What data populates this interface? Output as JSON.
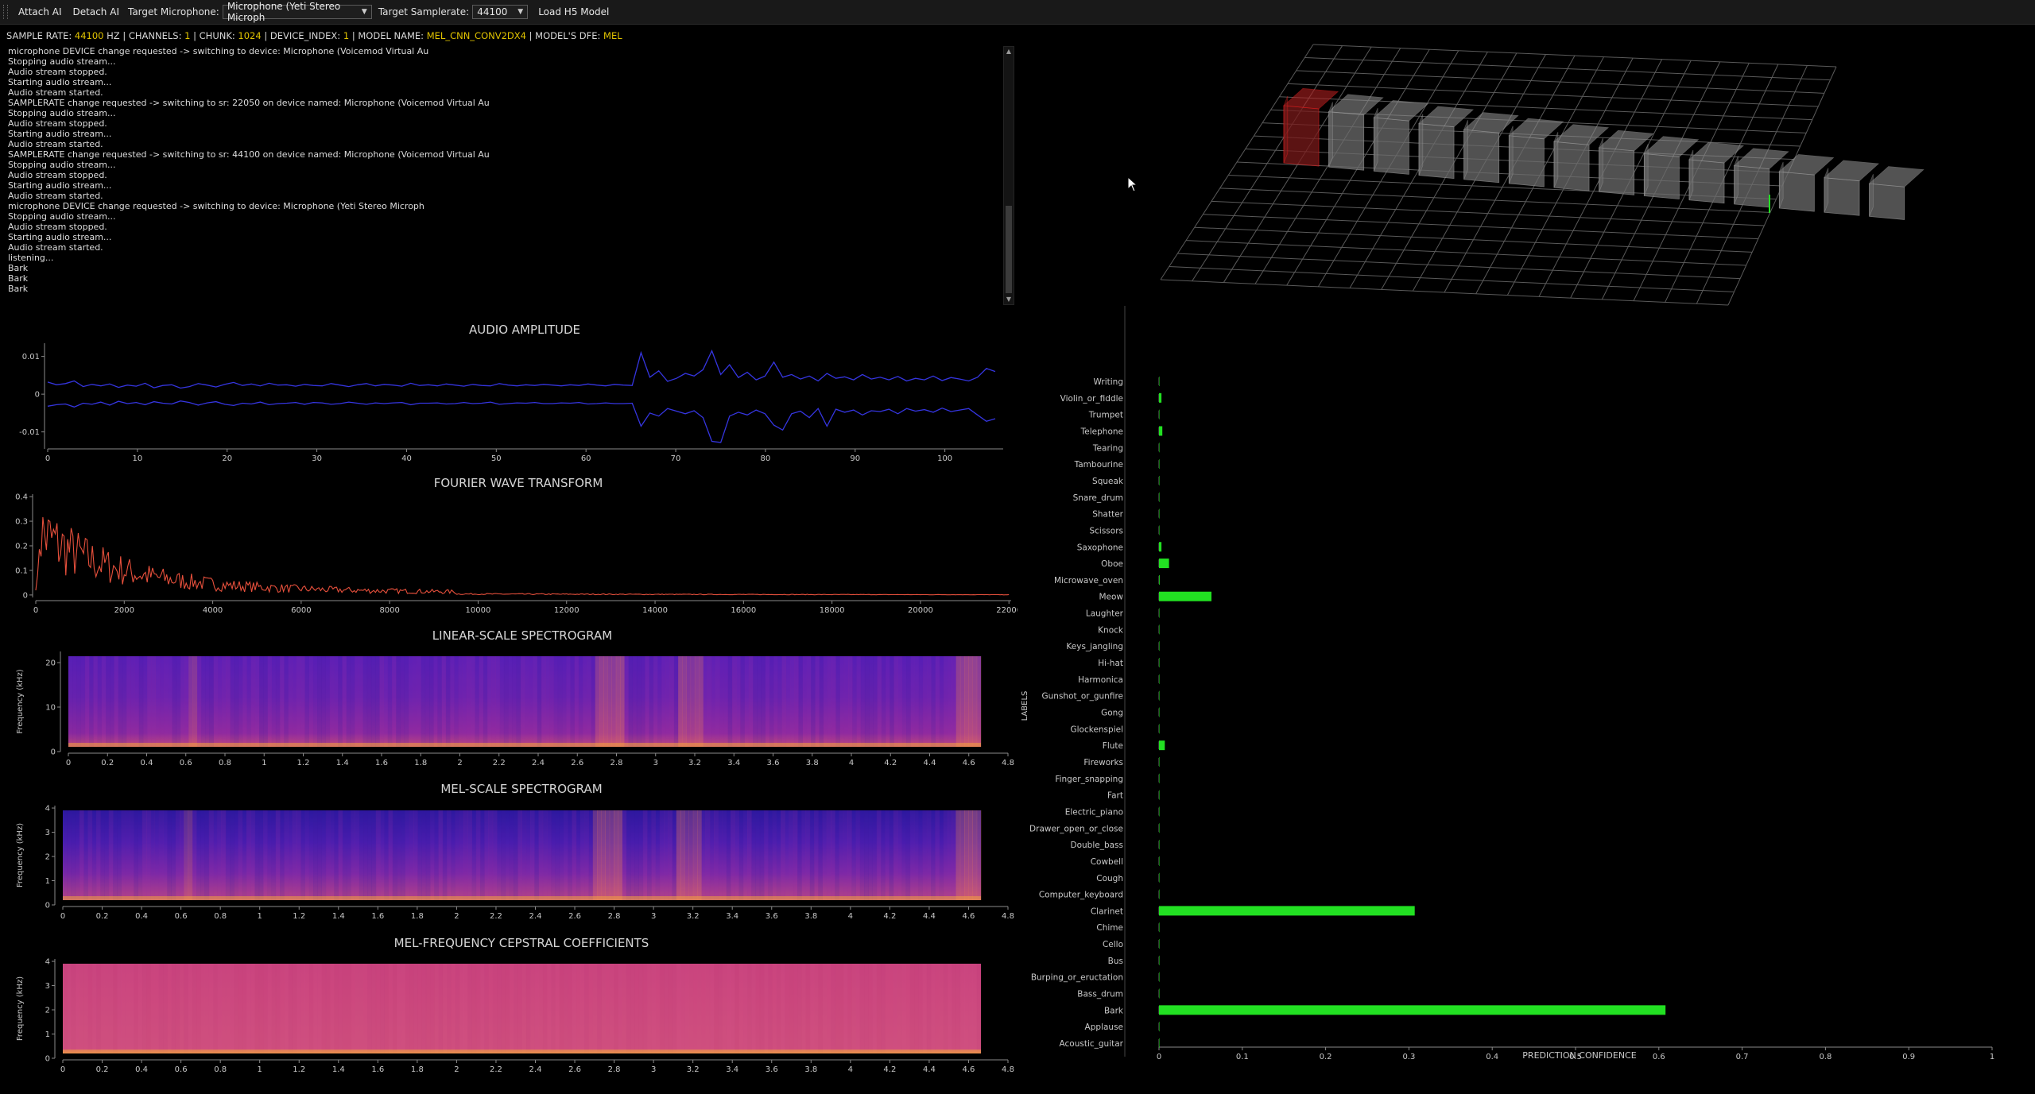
{
  "toolbar": {
    "attach": "Attach AI",
    "detach": "Detach AI",
    "mic_label": "Target Microphone:",
    "mic_value": "Microphone (Yeti Stereo Microph",
    "sr_label": "Target Samplerate:",
    "sr_value": "44100",
    "load": "Load H5 Model"
  },
  "info": {
    "sr_label": "SAMPLE RATE:",
    "sr_value": "44100",
    "sr_unit": "HZ |",
    "ch_label": "CHANNELS:",
    "ch_value": "1",
    "ch_sep": "|",
    "chunk_label": "CHUNK:",
    "chunk_value": "1024",
    "chunk_sep": "|",
    "dev_label": "DEVICE_INDEX:",
    "dev_value": "1",
    "dev_sep": "|",
    "model_label": "MODEL NAME:",
    "model_value": "MEL_CNN_CONV2DX4",
    "model_sep": "|",
    "dfe_label": "MODEL'S DFE:",
    "dfe_value": "MEL"
  },
  "log": [
    "microphone DEVICE change requested -> switching to device: Microphone (Voicemod Virtual Au",
    "Stopping audio stream...",
    "Audio stream stopped.",
    "Starting audio stream...",
    "Audio stream started.",
    "SAMPLERATE change requested -> switching to sr: 22050 on device named: Microphone (Voicemod Virtual Au",
    "Stopping audio stream...",
    "Audio stream stopped.",
    "Starting audio stream...",
    "Audio stream started.",
    "SAMPLERATE change requested -> switching to sr: 44100 on device named: Microphone (Voicemod Virtual Au",
    "Stopping audio stream...",
    "Audio stream stopped.",
    "Starting audio stream...",
    "Audio stream started.",
    "microphone DEVICE change requested -> switching to device: Microphone (Yeti Stereo Microph",
    "Stopping audio stream...",
    "Audio stream stopped.",
    "Starting audio stream...",
    "Audio stream started.",
    "listening...",
    "Bark",
    "Bark",
    "Bark"
  ],
  "colors": {
    "value_yellow": "#e0c300",
    "amplitude_line": "#3535e0",
    "fft_line": "#e8503c",
    "bar_green": "#22e022",
    "voxel_highlight": "#e02020"
  },
  "plots": {
    "amplitude": {
      "title": "AUDIO AMPLITUDE",
      "x_ticks": [
        "0",
        "10",
        "20",
        "30",
        "40",
        "50",
        "60",
        "70",
        "80",
        "90",
        "100"
      ],
      "y_ticks": [
        "0.01",
        "0",
        "-0.01"
      ],
      "upper": [
        0.0032,
        0.0025,
        0.0028,
        0.0035,
        0.002,
        0.0026,
        0.0022,
        0.0027,
        0.0018,
        0.0024,
        0.0021,
        0.0029,
        0.0017,
        0.0023,
        0.0025,
        0.0016,
        0.002,
        0.0028,
        0.0024,
        0.0019,
        0.0026,
        0.0031,
        0.0023,
        0.0027,
        0.0022,
        0.0029,
        0.0024,
        0.0025,
        0.0021,
        0.0026,
        0.0023,
        0.0022,
        0.0028,
        0.0024,
        0.002,
        0.0025,
        0.0028,
        0.0022,
        0.0026,
        0.0024,
        0.0021,
        0.0029,
        0.0023,
        0.0025,
        0.0022,
        0.0027,
        0.0024,
        0.0021,
        0.0026,
        0.0023,
        0.0022,
        0.0028,
        0.0024,
        0.0022,
        0.0025,
        0.0023,
        0.0026,
        0.0024,
        0.0022,
        0.0025,
        0.0023,
        0.0027,
        0.0024,
        0.0022,
        0.0026,
        0.0024,
        0.0023,
        0.011,
        0.0045,
        0.0062,
        0.0034,
        0.0042,
        0.0055,
        0.0048,
        0.0065,
        0.0115,
        0.0052,
        0.0078,
        0.0044,
        0.0058,
        0.0038,
        0.0048,
        0.0085,
        0.0045,
        0.0052,
        0.004,
        0.0048,
        0.0035,
        0.0055,
        0.0042,
        0.0046,
        0.0038,
        0.0052,
        0.004,
        0.0045,
        0.0038,
        0.0047,
        0.0035,
        0.0042,
        0.0038,
        0.0048,
        0.0036,
        0.0044,
        0.004,
        0.0035,
        0.0045,
        0.0068,
        0.006
      ],
      "lower": [
        -0.0032,
        -0.0028,
        -0.0026,
        -0.0034,
        -0.0024,
        -0.0027,
        -0.0021,
        -0.0029,
        -0.0019,
        -0.0025,
        -0.0022,
        -0.0028,
        -0.002,
        -0.0024,
        -0.0026,
        -0.0018,
        -0.0022,
        -0.0029,
        -0.0023,
        -0.002,
        -0.0027,
        -0.003,
        -0.0024,
        -0.0026,
        -0.0021,
        -0.0028,
        -0.0025,
        -0.0024,
        -0.0022,
        -0.0027,
        -0.0022,
        -0.0023,
        -0.0027,
        -0.0025,
        -0.0021,
        -0.0024,
        -0.0027,
        -0.0023,
        -0.0025,
        -0.0023,
        -0.0022,
        -0.0028,
        -0.0024,
        -0.0024,
        -0.0023,
        -0.0026,
        -0.0025,
        -0.0022,
        -0.0025,
        -0.0024,
        -0.0021,
        -0.0027,
        -0.0025,
        -0.0023,
        -0.0024,
        -0.0022,
        -0.0025,
        -0.0025,
        -0.0023,
        -0.0024,
        -0.0022,
        -0.0026,
        -0.0025,
        -0.0023,
        -0.0025,
        -0.0025,
        -0.0024,
        -0.0085,
        -0.005,
        -0.0058,
        -0.0038,
        -0.0045,
        -0.0052,
        -0.0044,
        -0.0062,
        -0.0125,
        -0.0128,
        -0.0058,
        -0.0048,
        -0.0055,
        -0.0042,
        -0.0052,
        -0.0082,
        -0.0095,
        -0.0052,
        -0.0045,
        -0.0062,
        -0.0038,
        -0.0085,
        -0.004,
        -0.0048,
        -0.0042,
        -0.0055,
        -0.0044,
        -0.0046,
        -0.004,
        -0.0052,
        -0.0038,
        -0.0045,
        -0.0041,
        -0.0048,
        -0.0037,
        -0.0046,
        -0.0042,
        -0.0038,
        -0.0055,
        -0.0072,
        -0.0065
      ]
    },
    "fft": {
      "title": "FOURIER WAVE TRANSFORM",
      "x_ticks": [
        "0",
        "2000",
        "4000",
        "6000",
        "8000",
        "10000",
        "12000",
        "14000",
        "16000",
        "18000",
        "20000",
        "22000"
      ],
      "y_ticks": [
        "0.4",
        "0.3",
        "0.2",
        "0.1",
        "0"
      ]
    },
    "linear": {
      "title": "LINEAR-SCALE SPECTROGRAM",
      "ylabel": "Frequency (kHz)",
      "y_ticks": [
        "20",
        "10",
        "0"
      ]
    },
    "mel": {
      "title": "MEL-SCALE SPECTROGRAM",
      "ylabel": "Frequency (kHz)",
      "y_ticks": [
        "4",
        "3",
        "2",
        "1",
        "0"
      ]
    },
    "mfcc": {
      "title": "MEL-FREQUENCY CEPSTRAL COEFFICIENTS",
      "ylabel": "Frequency (kHz)",
      "y_ticks": [
        "4",
        "3",
        "2",
        "1",
        "0"
      ]
    },
    "time_ticks": [
      "0",
      "0.2",
      "0.4",
      "0.6",
      "0.8",
      "1",
      "1.2",
      "1.4",
      "1.6",
      "1.8",
      "2",
      "2.2",
      "2.4",
      "2.6",
      "2.8",
      "3",
      "3.2",
      "3.4",
      "3.6",
      "3.8",
      "4",
      "4.2",
      "4.4",
      "4.6",
      "4.8"
    ]
  },
  "chart_data": {
    "type": "bar",
    "orientation": "horizontal",
    "xlabel": "PREDICTION CONFIDENCE",
    "ylabel": "LABELS",
    "xlim": [
      0,
      1
    ],
    "x_ticks": [
      "0",
      "0.1",
      "0.2",
      "0.3",
      "0.4",
      "0.5",
      "0.6",
      "0.7",
      "0.8",
      "0.9",
      "1"
    ],
    "categories": [
      "Writing",
      "Violin_or_fiddle",
      "Trumpet",
      "Telephone",
      "Tearing",
      "Tambourine",
      "Squeak",
      "Snare_drum",
      "Shatter",
      "Scissors",
      "Saxophone",
      "Oboe",
      "Microwave_oven",
      "Meow",
      "Laughter",
      "Knock",
      "Keys_jangling",
      "Hi-hat",
      "Harmonica",
      "Gunshot_or_gunfire",
      "Gong",
      "Glockenspiel",
      "Flute",
      "Fireworks",
      "Finger_snapping",
      "Fart",
      "Electric_piano",
      "Drawer_open_or_close",
      "Double_bass",
      "Cowbell",
      "Cough",
      "Computer_keyboard",
      "Clarinet",
      "Chime",
      "Cello",
      "Bus",
      "Burping_or_eructation",
      "Bass_drum",
      "Bark",
      "Applause",
      "Acoustic_guitar"
    ],
    "values": [
      0.0005,
      0.003,
      0.0005,
      0.004,
      0.0005,
      0.0005,
      0.0005,
      0.0005,
      0.0005,
      0.0005,
      0.003,
      0.012,
      0.0008,
      0.063,
      0.0005,
      0.0005,
      0.0005,
      0.0005,
      0.0005,
      0.0005,
      0.0005,
      0.0005,
      0.007,
      0.0005,
      0.0005,
      0.0005,
      0.0005,
      0.0005,
      0.0005,
      0.0005,
      0.0005,
      0.0005,
      0.307,
      0.0005,
      0.0005,
      0.0005,
      0.0005,
      0.0005,
      0.608,
      0.0005,
      0.0005
    ]
  }
}
